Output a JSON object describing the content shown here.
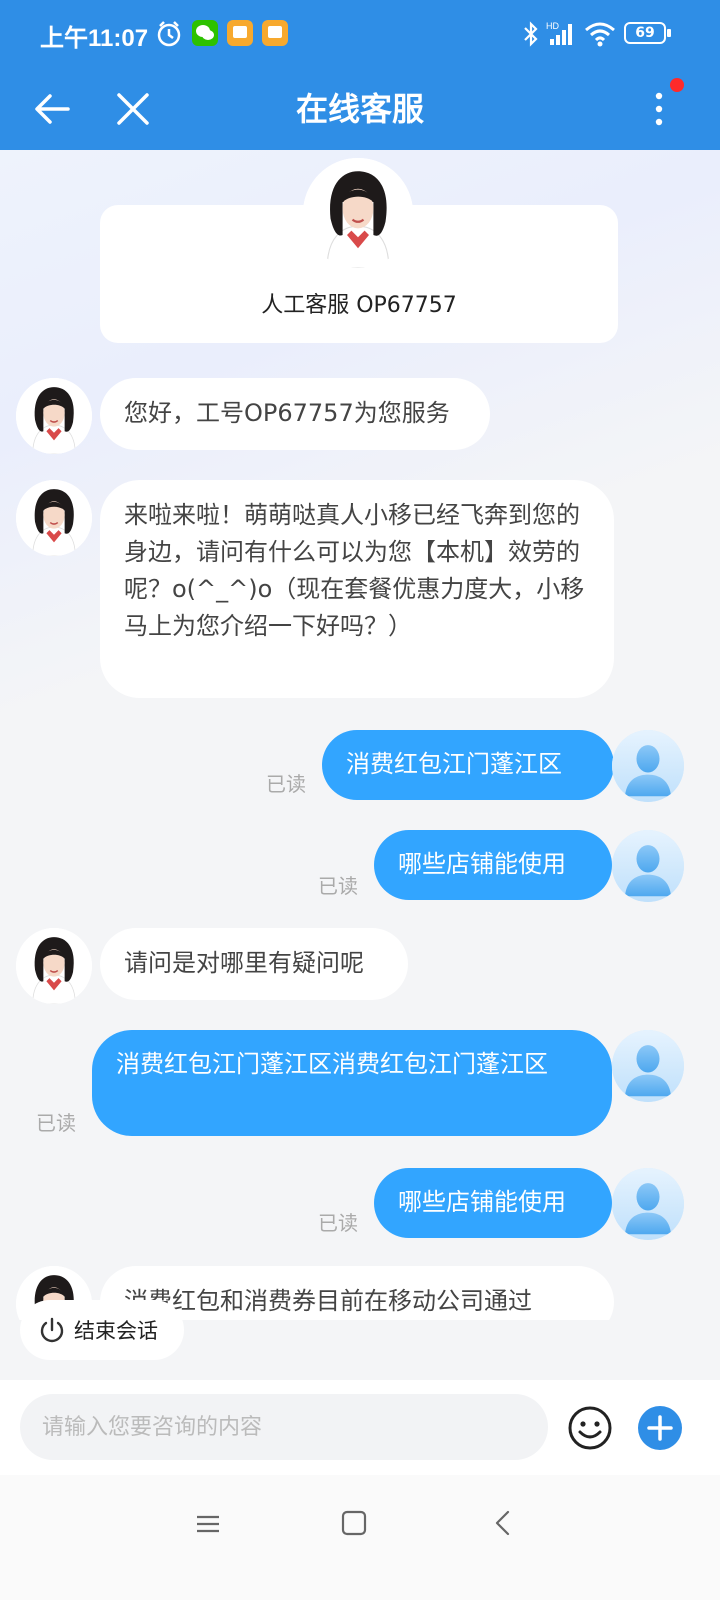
{
  "status_bar": {
    "time": "上午11:07",
    "battery": "69"
  },
  "header": {
    "title": "在线客服"
  },
  "agent_card": {
    "name": "人工客服 OP67757"
  },
  "messages": {
    "m1": "您好，工号OP67757为您服务",
    "m2": "来啦来啦！萌萌哒真人小移已经飞奔到您的身边，请问有什么可以为您【本机】效劳的呢？o(^_^)o（现在套餐优惠力度大，小移马上为您介绍一下好吗？）",
    "m3": "消费红包江门蓬江区",
    "m4": "哪些店铺能使用",
    "m5": "请问是对哪里有疑问呢",
    "m6": "消费红包江门蓬江区消费红包江门蓬江区",
    "m7": "哪些店铺能使用",
    "m8": "消费红包和消费券目前在移动公司通过"
  },
  "read_label": "已读",
  "end_session": {
    "label": "结束会话"
  },
  "input": {
    "placeholder": "请输入您要咨询的内容"
  },
  "colors": {
    "header": "#2f8ee6",
    "user_bubble": "#32a5ff",
    "notify_dot": "#ff2a2a"
  }
}
